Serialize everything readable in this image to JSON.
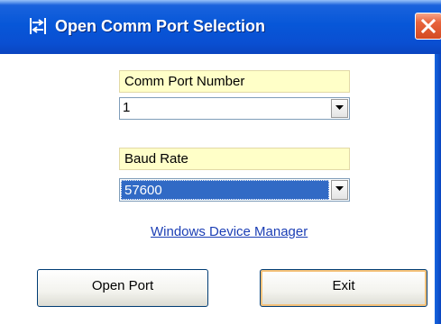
{
  "window": {
    "title": "Open Comm Port Selection"
  },
  "icons": {
    "app_icon": "transfer-arrows-icon",
    "close_icon": "close-icon",
    "dropdown_icon": "chevron-down-icon"
  },
  "comm_port": {
    "label": "Comm Port Number",
    "selected_value": "1"
  },
  "baud_rate": {
    "label": "Baud Rate",
    "selected_value": "57600"
  },
  "device_manager_link": "Windows Device Manager",
  "buttons": {
    "open_port": "Open Port",
    "exit": "Exit"
  },
  "colors": {
    "titlebar": "#0757d8",
    "label_background": "#ffffc8",
    "selection_highlight": "#316ac5",
    "link": "#1c3fb5",
    "close_button": "#e8643c"
  }
}
